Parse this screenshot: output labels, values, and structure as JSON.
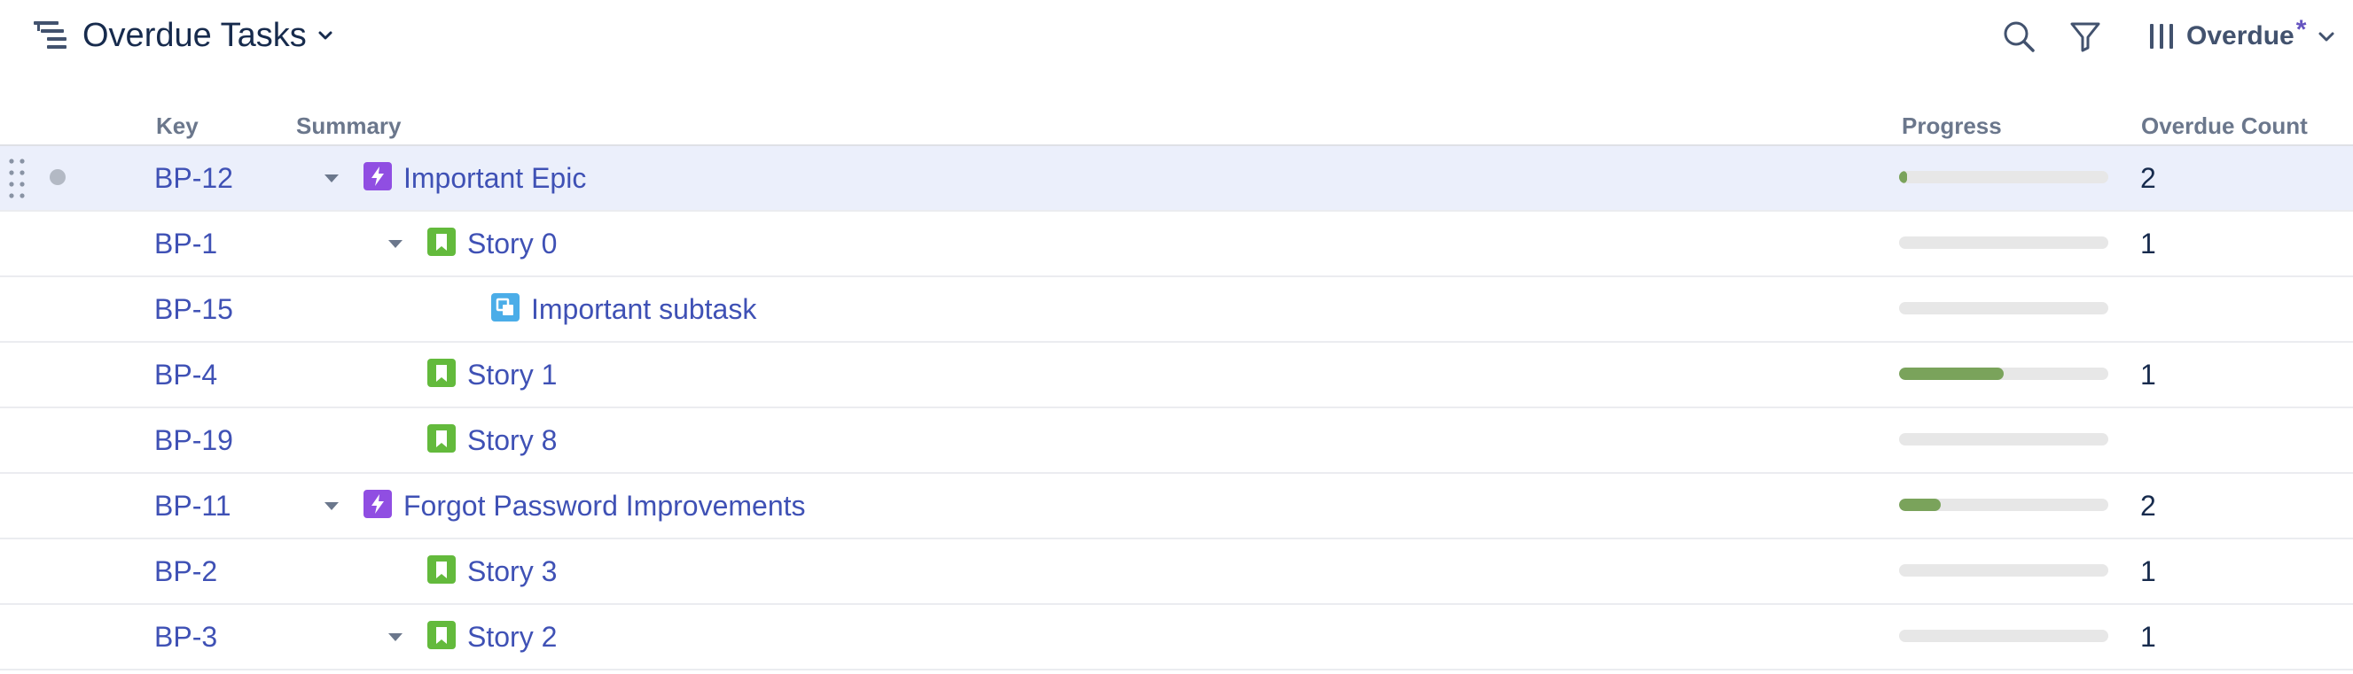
{
  "header": {
    "title": "Overdue Tasks",
    "view_label": "Overdue",
    "view_modified_marker": "*"
  },
  "columns": {
    "key": "Key",
    "summary": "Summary",
    "progress": "Progress",
    "overdue_count": "Overdue Count"
  },
  "colors": {
    "link": "#3f51b5",
    "epic_icon": "#904ee2",
    "story_icon": "#63ba3c",
    "subtask_icon": "#4bade8",
    "progress_fill": "#7aa35b",
    "selected_row": "#ebeffb"
  },
  "rows": [
    {
      "key": "BP-12",
      "summary": "Important Epic",
      "type": "epic-icon",
      "level": 0,
      "expanded": true,
      "progress": 0.04,
      "overdue": "2",
      "selected": true
    },
    {
      "key": "BP-1",
      "summary": "Story 0",
      "type": "story-icon",
      "level": 1,
      "expanded": true,
      "progress": 0,
      "overdue": "1",
      "selected": false
    },
    {
      "key": "BP-15",
      "summary": "Important subtask",
      "type": "subtask-icon",
      "level": 2,
      "expanded": false,
      "progress": 0,
      "overdue": "",
      "selected": false
    },
    {
      "key": "BP-4",
      "summary": "Story 1",
      "type": "story-icon",
      "level": 1,
      "expanded": false,
      "progress": 0.5,
      "overdue": "1",
      "selected": false
    },
    {
      "key": "BP-19",
      "summary": "Story 8",
      "type": "story-icon",
      "level": 1,
      "expanded": false,
      "progress": 0,
      "overdue": "",
      "selected": false
    },
    {
      "key": "BP-11",
      "summary": "Forgot Password Improvements",
      "type": "epic-icon",
      "level": 0,
      "expanded": true,
      "progress": 0.2,
      "overdue": "2",
      "selected": false
    },
    {
      "key": "BP-2",
      "summary": "Story 3",
      "type": "story-icon",
      "level": 1,
      "expanded": false,
      "progress": 0,
      "overdue": "1",
      "selected": false
    },
    {
      "key": "BP-3",
      "summary": "Story 2",
      "type": "story-icon",
      "level": 1,
      "expanded": true,
      "progress": 0,
      "overdue": "1",
      "selected": false
    }
  ]
}
